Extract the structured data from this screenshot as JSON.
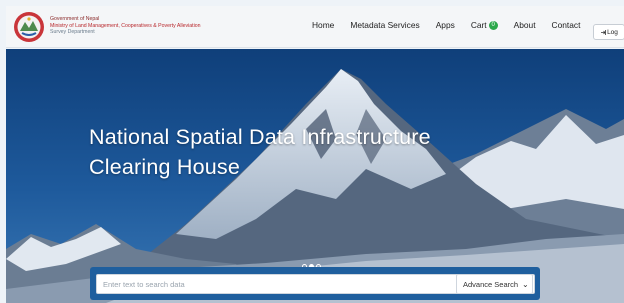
{
  "org": {
    "line1": "Government of Nepal",
    "line2": "Ministry of Land Management, Cooperatives & Poverty Alleviation",
    "line3": "Survey Department"
  },
  "nav": {
    "home": "Home",
    "metadata": "Metadata Services",
    "apps": "Apps",
    "cart": "Cart",
    "cart_count": "0",
    "about": "About",
    "contact": "Contact",
    "login": "Log"
  },
  "hero": {
    "title_line1": "National Spatial Data Infrastructure",
    "title_line2": "Clearing House",
    "slides": 3,
    "active_slide": 1
  },
  "search": {
    "placeholder": "Enter text to search data",
    "advance_label": "Advance Search"
  },
  "icons": {
    "search": "search-icon",
    "login": "login-icon",
    "chevron": "chevron-down-icon"
  },
  "colors": {
    "search_bar": "#1f5f9e",
    "cart_badge": "#2ba84a",
    "org_red": "#b8272b"
  }
}
